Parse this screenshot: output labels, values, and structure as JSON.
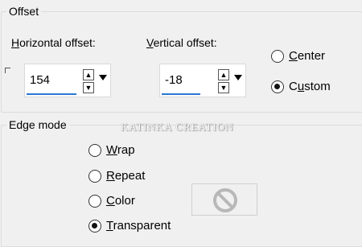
{
  "offset_group": {
    "title": "Offset",
    "horizontal": {
      "label_ul": "H",
      "label_rest": "orizontal offset:",
      "value": "154"
    },
    "vertical": {
      "label_ul": "V",
      "label_rest": "ertical offset:",
      "value": "-18"
    },
    "center": {
      "label_ul": "C",
      "label_rest": "enter",
      "checked": false
    },
    "custom": {
      "label_pre": "C",
      "label_ul": "u",
      "label_rest": "stom",
      "checked": true
    }
  },
  "edge_group": {
    "title": "Edge mode",
    "options": [
      {
        "pre": "",
        "ul": "W",
        "rest": "rap",
        "checked": false
      },
      {
        "pre": "",
        "ul": "R",
        "rest": "epeat",
        "checked": false
      },
      {
        "pre": "",
        "ul": "C",
        "rest": "olor",
        "checked": false
      },
      {
        "pre": "",
        "ul": "T",
        "rest": "ransparent",
        "checked": true
      }
    ]
  },
  "watermark": "KATINKA CREATION",
  "icons": {
    "preview": "no-sign-icon",
    "spin_up": "triangle-up-icon",
    "spin_down": "triangle-down-icon",
    "dropdown": "chevron-down-icon"
  },
  "colors": {
    "focus_underline": "#2a78d2",
    "background": "#f0f0f0"
  }
}
